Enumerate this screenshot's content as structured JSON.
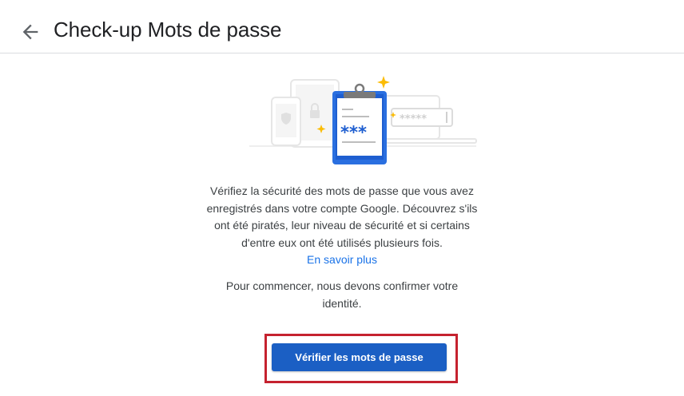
{
  "header": {
    "back_icon": "arrow-back-icon",
    "title": "Check-up Mots de passe"
  },
  "illustration": {
    "icons": [
      "phone-shield-icon",
      "tablet-lock-icon",
      "clipboard-password-icon",
      "laptop-password-field-icon",
      "sparkle-icon"
    ],
    "clipboard_text": "***",
    "password_field_text": "*****"
  },
  "content": {
    "description": "Vérifiez la sécurité des mots de passe que vous avez enregistrés dans votre compte Google. Découvrez s'ils ont été piratés, leur niveau de sécurité et si certains d'entre eux ont été utilisés plusieurs fois.",
    "learn_more": "En savoir plus",
    "start_text": "Pour commencer, nous devons confirmer votre identité.",
    "primary_button": "Vérifier les mots de passe"
  },
  "colors": {
    "primary": "#1b5fc4",
    "link": "#1a73e8",
    "highlight": "#c5222f",
    "sparkle": "#fbbc04"
  }
}
